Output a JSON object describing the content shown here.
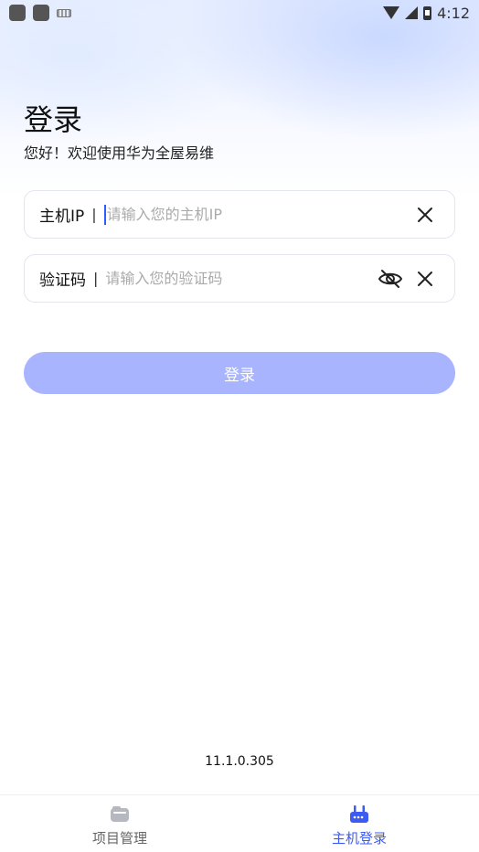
{
  "status_bar": {
    "time": "4:12",
    "icons": [
      "app-notification-icon",
      "app-notification-icon",
      "keyboard-icon",
      "wifi-icon",
      "cell-signal-icon",
      "battery-icon"
    ]
  },
  "header": {
    "title": "登录",
    "subtitle": "您好！欢迎使用华为全屋易维"
  },
  "form": {
    "host_ip": {
      "label": "主机IP",
      "separator": "|",
      "value": "",
      "placeholder": "请输入您的主机IP"
    },
    "code": {
      "label": "验证码",
      "separator": "|",
      "value": "",
      "placeholder": "请输入您的验证码"
    },
    "submit_label": "登录"
  },
  "footer": {
    "version": "11.1.0.305"
  },
  "tabbar": {
    "items": [
      {
        "label": "项目管理",
        "icon": "folder-icon",
        "active": false
      },
      {
        "label": "主机登录",
        "icon": "router-icon",
        "active": true
      }
    ]
  },
  "colors": {
    "accent": "#3d5bf0",
    "button_disabled": "#a9b4ff",
    "cursor": "#2f5cff"
  }
}
